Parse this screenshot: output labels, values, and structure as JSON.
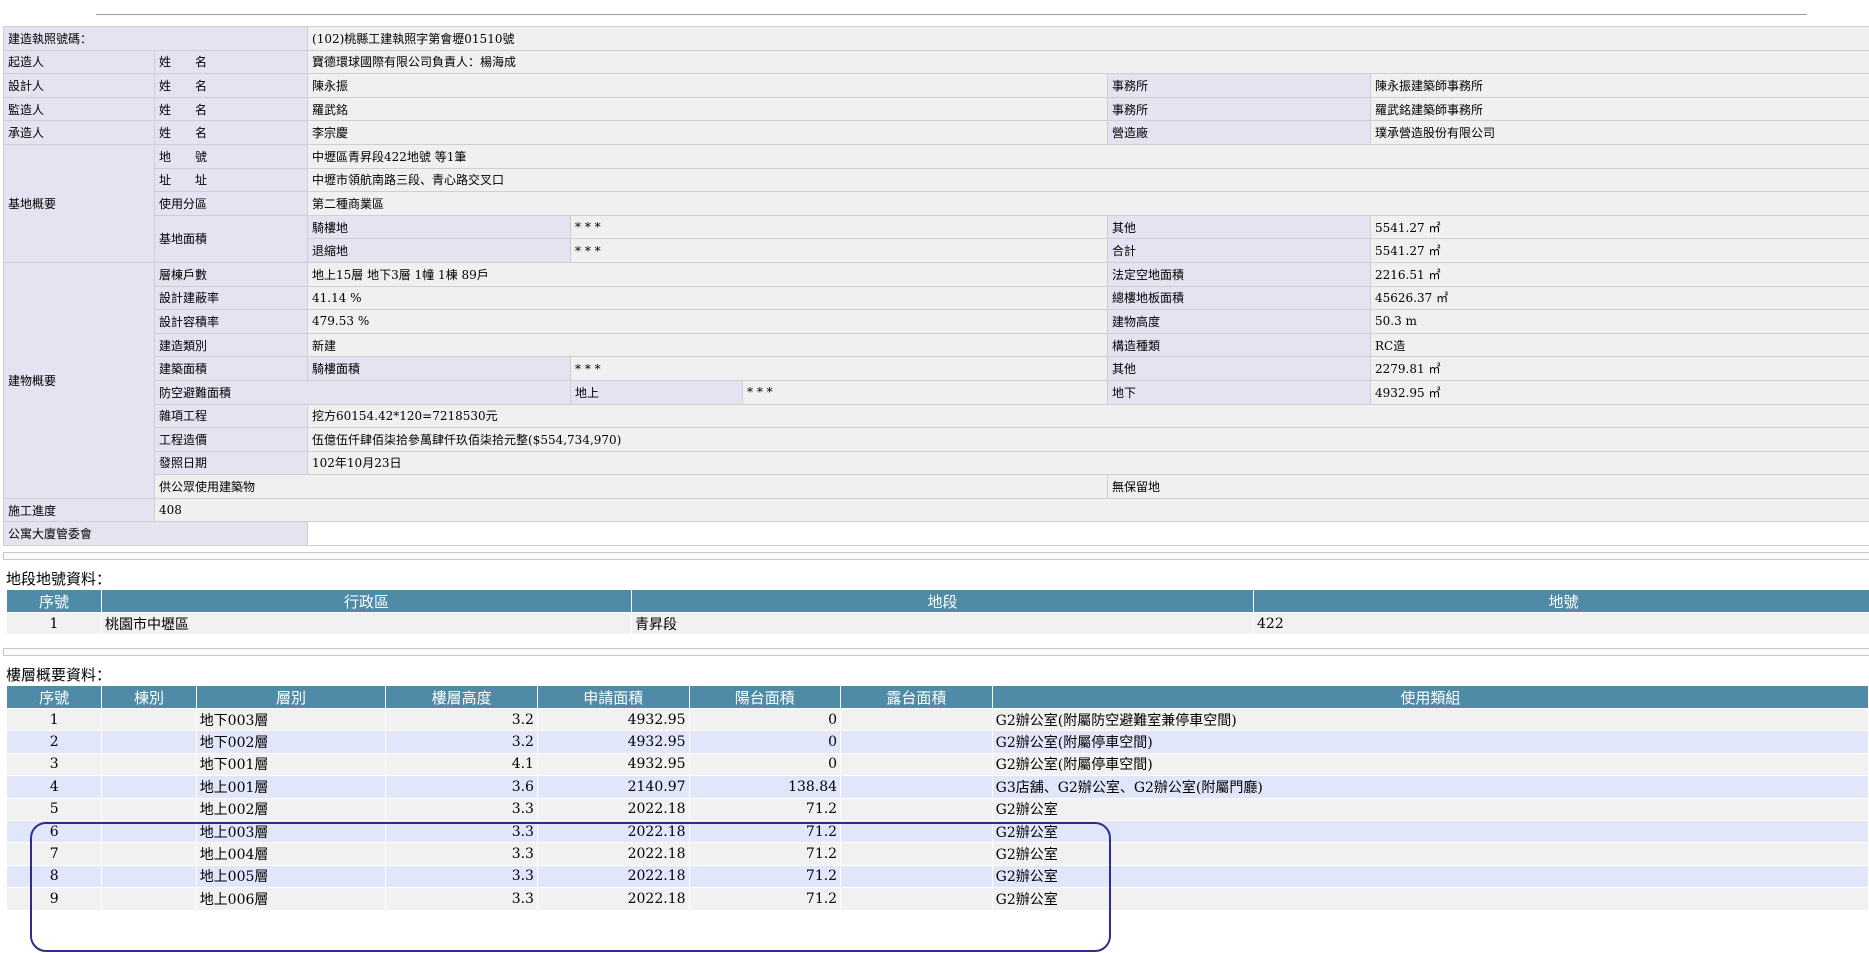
{
  "header": {
    "permit_no_label": "建造執照號碼：",
    "permit_no_value": "(102)桃縣工建執照字第會壢01510號"
  },
  "people": {
    "applicant": {
      "role": "起造人",
      "name_label": "姓　　名",
      "name": "寶德環球國際有限公司負責人：楊海成"
    },
    "designer": {
      "role": "設計人",
      "name_label": "姓　　名",
      "name": "陳永振",
      "office_label": "事務所",
      "office": "陳永振建築師事務所"
    },
    "supervisor": {
      "role": "監造人",
      "name_label": "姓　　名",
      "name": "羅武銘",
      "office_label": "事務所",
      "office": "羅武銘建築師事務所"
    },
    "contractor": {
      "role": "承造人",
      "name_label": "姓　　名",
      "name": "李宗慶",
      "office_label": "營造廠",
      "office": "璞承營造股份有限公司"
    }
  },
  "site": {
    "section_label": "基地概要",
    "lot_label": "地　　號",
    "lot_value": "中壢區青昇段422地號 等1筆",
    "address_label": "址　　址",
    "address_value": "中壢市領航南路三段、青心路交叉口",
    "zoning_label": "使用分區",
    "zoning_value": "第二種商業區",
    "area_label": "基地面積",
    "arcade_label": "騎樓地",
    "arcade_value": "* * *",
    "other_label": "其他",
    "other_value": "5541.27 ㎡",
    "setback_label": "退縮地",
    "setback_value": "* * *",
    "total_label": "合計",
    "total_value": "5541.27 ㎡"
  },
  "building": {
    "section_label": "建物概要",
    "floors_label": "層棟戶數",
    "floors_value": "地上15層 地下3層 1幢 1棟 89戶",
    "open_space_label": "法定空地面積",
    "open_space_value": "2216.51 ㎡",
    "coverage_label": "設計建蔽率",
    "coverage_value": "41.14 %",
    "floor_area_label": "總樓地板面積",
    "floor_area_value": "45626.37 ㎡",
    "far_label": "設計容積率",
    "far_value": "479.53 %",
    "height_label": "建物高度",
    "height_value": "50.3 m",
    "type_label": "建造類別",
    "type_value": "新建",
    "structure_label": "構造種類",
    "structure_value": "RC造",
    "bldg_area_label": "建築面積",
    "bldg_arcade_label": "騎樓面積",
    "bldg_arcade_value": "* * *",
    "bldg_other_label": "其他",
    "bldg_other_value": "2279.81 ㎡",
    "shelter_label": "防空避難面積",
    "shelter_above_label": "地上",
    "shelter_above_value": "* * *",
    "shelter_below_label": "地下",
    "shelter_below_value": "4932.95 ㎡",
    "misc_label": "雜項工程",
    "misc_value": "挖方60154.42*120=7218530元",
    "cost_label": "工程造價",
    "cost_value": "伍億伍仟肆佰柒拾參萬肆仟玖佰柒拾元整($554,734,970)",
    "issue_label": "發照日期",
    "issue_value": "102年10月23日",
    "public_label": "供公眾使用建築物",
    "reserve_label": "無保留地"
  },
  "progress": {
    "label": "施工進度",
    "value": "408"
  },
  "committee": {
    "label": "公寓大廈管委會"
  },
  "land_section": {
    "title": "地段地號資料：",
    "headers": [
      "序號",
      "行政區",
      "地段",
      "地號"
    ],
    "rows": [
      [
        "1",
        "桃園市中壢區",
        "青昇段",
        "422"
      ]
    ]
  },
  "floor_section": {
    "title": "樓層概要資料：",
    "headers": [
      "序號",
      "棟別",
      "層別",
      "樓層高度",
      "申請面積",
      "陽台面積",
      "露台面積",
      "使用類組"
    ],
    "rows": [
      [
        "1",
        "",
        "地下003層",
        "3.2",
        "4932.95",
        "0",
        "",
        "G2辦公室(附屬防空避難室兼停車空間)"
      ],
      [
        "2",
        "",
        "地下002層",
        "3.2",
        "4932.95",
        "0",
        "",
        "G2辦公室(附屬停車空間)"
      ],
      [
        "3",
        "",
        "地下001層",
        "4.1",
        "4932.95",
        "0",
        "",
        "G2辦公室(附屬停車空間)"
      ],
      [
        "4",
        "",
        "地上001層",
        "3.6",
        "2140.97",
        "138.84",
        "",
        "G3店舖、G2辦公室、G2辦公室(附屬門廳)"
      ],
      [
        "5",
        "",
        "地上002層",
        "3.3",
        "2022.18",
        "71.2",
        "",
        "G2辦公室"
      ],
      [
        "6",
        "",
        "地上003層",
        "3.3",
        "2022.18",
        "71.2",
        "",
        "G2辦公室"
      ],
      [
        "7",
        "",
        "地上004層",
        "3.3",
        "2022.18",
        "71.2",
        "",
        "G2辦公室"
      ],
      [
        "8",
        "",
        "地上005層",
        "3.3",
        "2022.18",
        "71.2",
        "",
        "G2辦公室"
      ],
      [
        "9",
        "",
        "地上006層",
        "3.3",
        "2022.18",
        "71.2",
        "",
        "G2辦公室"
      ]
    ]
  },
  "colors": {
    "header_bg": "#4f8ba6",
    "label_bg": "#e3e3f2",
    "value_bg": "#f0f0f0",
    "row_alt_bg": "#e2e6fa",
    "highlight_border": "#2b2f8a"
  }
}
